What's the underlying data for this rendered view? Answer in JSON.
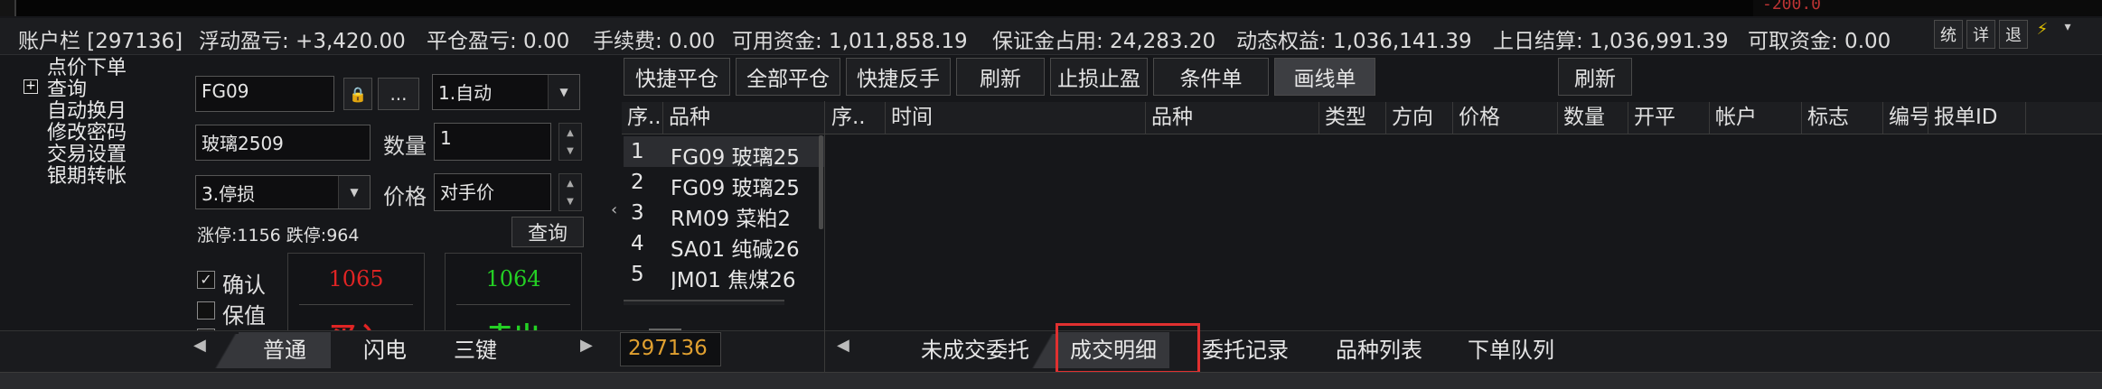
{
  "account": {
    "label": "账户栏 [297136]",
    "floating_pnl": "浮动盈亏: +3,420.00",
    "close_pnl": "平仓盈亏: 0.00",
    "fee": "手续费: 0.00",
    "available": "可用资金: 1,011,858.19",
    "margin": "保证金占用: 24,283.20",
    "equity": "动态权益: 1,036,141.39",
    "prev_settle": "上日结算: 1,036,991.39",
    "withdrawable": "可取资金: 0.00",
    "btn_stats": "统",
    "btn_detail": "详",
    "btn_exit": "退",
    "top_fragment": "-200.0"
  },
  "menu": {
    "items": [
      "点价下单",
      "查询",
      "自动换月",
      "修改密码",
      "交易设置",
      "银期转帐"
    ]
  },
  "order": {
    "contract": "FG09",
    "lock_glyph": "🔒",
    "more_label": "...",
    "mode": "1.自动",
    "name": "玻璃2509",
    "qty_label": "数量",
    "qty": "1",
    "order_type": "3.停损",
    "price_label": "价格",
    "price": "对手价",
    "limits": "涨停:1156 跌停:964",
    "query_btn": "查询",
    "confirm_label": "确认",
    "hedge_label": "保值",
    "buy_price": "1065",
    "sell_price": "1064",
    "buy_label": "买入",
    "sell_label": "卖出"
  },
  "toolbar": {
    "quick_close": "快捷平仓",
    "close_all": "全部平仓",
    "quick_reverse": "快捷反手",
    "refresh": "刷新",
    "stop": "止损止盈",
    "cond": "条件单",
    "draw": "画线单",
    "refresh2": "刷新"
  },
  "products": {
    "col_seq": "序..",
    "col_name": "品种",
    "rows": [
      {
        "seq": "1",
        "name": "FG09 玻璃25"
      },
      {
        "seq": "2",
        "name": "FG09 玻璃25"
      },
      {
        "seq": "3",
        "name": "RM09 菜粕2"
      },
      {
        "seq": "4",
        "name": "SA01 纯碱26"
      },
      {
        "seq": "5",
        "name": "JM01 焦煤26"
      }
    ],
    "account_value": "297136"
  },
  "trades": {
    "columns": [
      "序..",
      "时间",
      "品种",
      "类型",
      "方向",
      "价格",
      "数量",
      "开平",
      "帐户",
      "标志",
      "编号",
      "报单ID"
    ]
  },
  "bottom_tabs": {
    "left": [
      "普通",
      "闪电",
      "三键"
    ],
    "right": [
      "未成交委托",
      "成交明细",
      "委托记录",
      "品种列表",
      "下单队列"
    ]
  },
  "colors": {
    "buy": "#e02424",
    "sell": "#24d024",
    "highlight": "#e03030",
    "lock": "#3fbf3f",
    "account": "#e0a030"
  }
}
